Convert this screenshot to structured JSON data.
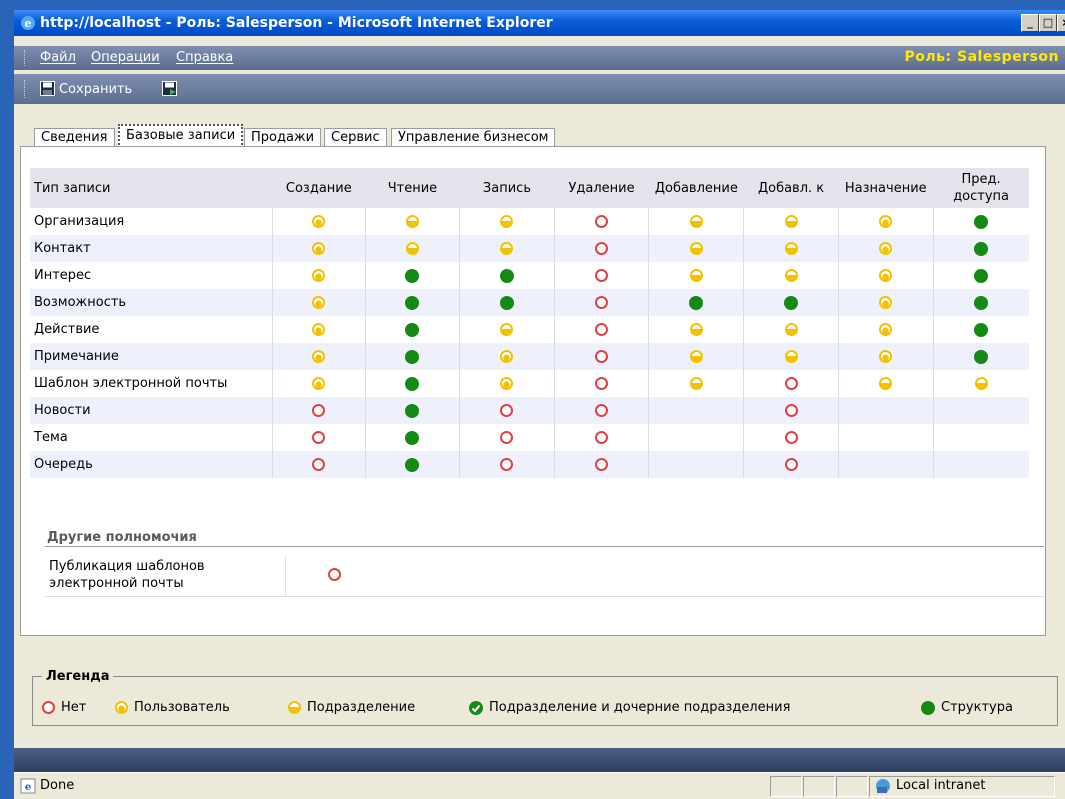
{
  "window": {
    "title": "http://localhost - Роль: Salesperson - Microsoft Internet Explorer"
  },
  "menu": {
    "items": [
      "Файл",
      "Операции",
      "Справка"
    ],
    "role_label": "Роль: Salesperson"
  },
  "toolbar": {
    "save_label": "Сохранить"
  },
  "tabs": [
    "Сведения",
    "Базовые записи",
    "Продажи",
    "Сервис",
    "Управление бизнесом"
  ],
  "active_tab": "Базовые записи",
  "grid": {
    "headers": [
      "Тип записи",
      "Создание",
      "Чтение",
      "Запись",
      "Удаление",
      "Добавление",
      "Добавл. к",
      "Назначение",
      "Пред. доступа"
    ],
    "rows": [
      {
        "label": "Организация",
        "levels": [
          "user",
          "bu",
          "bu",
          "none",
          "bu",
          "bu",
          "user",
          "org"
        ]
      },
      {
        "label": "Контакт",
        "levels": [
          "user",
          "bu",
          "bu",
          "none",
          "bu",
          "bu",
          "user",
          "org"
        ]
      },
      {
        "label": "Интерес",
        "levels": [
          "user",
          "org",
          "org",
          "none",
          "bu",
          "bu",
          "user",
          "org"
        ]
      },
      {
        "label": "Возможность",
        "levels": [
          "user",
          "org",
          "org",
          "none",
          "org",
          "org",
          "user",
          "org"
        ]
      },
      {
        "label": "Действие",
        "levels": [
          "user",
          "org",
          "bu",
          "none",
          "bu",
          "bu",
          "user",
          "org"
        ]
      },
      {
        "label": "Примечание",
        "levels": [
          "user",
          "org",
          "user",
          "none",
          "bu",
          "bu",
          "user",
          "org"
        ]
      },
      {
        "label": "Шаблон электронной почты",
        "levels": [
          "user",
          "org",
          "user",
          "none",
          "bu",
          "none",
          "bu",
          "bu"
        ]
      },
      {
        "label": "Новости",
        "levels": [
          "none",
          "org",
          "none",
          "none",
          "",
          "none",
          "",
          ""
        ]
      },
      {
        "label": "Тема",
        "levels": [
          "none",
          "org",
          "none",
          "none",
          "",
          "none",
          "",
          ""
        ]
      },
      {
        "label": "Очередь",
        "levels": [
          "none",
          "org",
          "none",
          "none",
          "",
          "none",
          "",
          ""
        ]
      }
    ]
  },
  "other": {
    "title": "Другие полномочия",
    "items": [
      {
        "label": "Публикация шаблонов электронной почты",
        "level": "none"
      }
    ]
  },
  "legend": {
    "title": "Легенда",
    "items": [
      {
        "level": "none",
        "label": "Нет"
      },
      {
        "level": "user",
        "label": "Пользователь"
      },
      {
        "level": "bu",
        "label": "Подразделение"
      },
      {
        "level": "bu-child",
        "label": "Подразделение и дочерние подразделения"
      },
      {
        "level": "org",
        "label": "Структура"
      }
    ]
  },
  "status": {
    "text": "Done",
    "zone": "Local intranet"
  },
  "colors": {
    "green": "#138a13",
    "yellow": "#f2c200",
    "red": "#e04040",
    "title_blue": "#0a5fd8",
    "role_yellow": "#ffea00"
  }
}
